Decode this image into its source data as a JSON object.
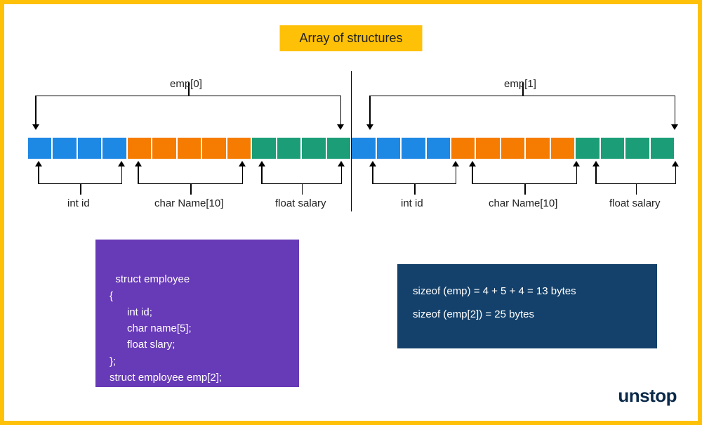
{
  "title": "Array of structures",
  "top_labels": {
    "emp0": "emp[0]",
    "emp1": "emp[1]"
  },
  "bottom_labels": {
    "int_id": "int id",
    "char_name": "char Name[10]",
    "float_salary": "float salary"
  },
  "code_box": "struct employee\n{\n      int id;\n      char name[5];\n      float slary;\n};\nstruct employee emp[2];",
  "size_box": {
    "line1": "sizeof (emp) =  4 + 5 + 4 = 13 bytes",
    "line2": "sizeof (emp[2]) = 25 bytes"
  },
  "logo": "unstop",
  "memory_layout": {
    "emp0": {
      "int_id_cells": 4,
      "char_name_cells": 5,
      "float_salary_cells": 4
    },
    "emp1": {
      "int_id_cells": 4,
      "char_name_cells": 5,
      "float_salary_cells": 4
    }
  }
}
